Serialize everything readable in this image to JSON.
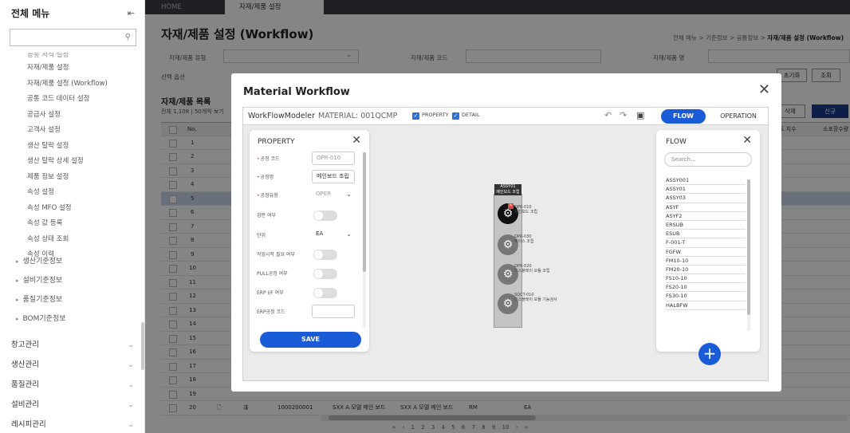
{
  "sidebar": {
    "title": "전체 메뉴",
    "search_placeholder": "",
    "cut_item": "공통 서식 설정",
    "sub_items": [
      "자재/제품 설정",
      "자재/제품 설정 (Workflow)",
      "공통 코드 데이터 설정",
      "공급사 설정",
      "고객사 설정",
      "생산 탈락 설정",
      "생산 탈락 상세 설정",
      "제품 정보 설정",
      "속성 설정",
      "속성 MFO 설정",
      "속성 값 등록",
      "속성 상태 조회",
      "속성 이력"
    ],
    "groups": [
      "생산기준정보",
      "설비기준정보",
      "품질기준정보",
      "BOM기준정보"
    ],
    "top_menus": [
      "창고관리",
      "생산관리",
      "품질관리",
      "설비관리",
      "레시피관리"
    ]
  },
  "tabs": {
    "home": "HOME",
    "active": "자재/제품 설정 (Workflow)"
  },
  "page": {
    "title": "자재/제품 설정 (Workflow)",
    "breadcrumb": [
      "전체 메뉴",
      "기준정보",
      "공통정보",
      "자재/제품 설정 (Workflow)"
    ],
    "filters": {
      "type_label": "자재/제품 유형",
      "code_label": "자재/제품 코드",
      "name_label": "자재/제품 명",
      "option_label": "선택 옵션"
    },
    "buttons": {
      "reset": "초기화",
      "search": "조회",
      "delete": "삭제",
      "new": "신규"
    },
    "list_title": "자재/제품 목록",
    "list_sub": "전체 1,108 | 50개씩 보기",
    "columns": [
      "No.",
      "트 치수",
      "소포장수량"
    ],
    "row_numbers": [
      "1",
      "2",
      "3",
      "4",
      "5",
      "6",
      "7",
      "8",
      "9",
      "10",
      "11",
      "12",
      "13",
      "14",
      "15",
      "16",
      "17",
      "18",
      "19",
      "20"
    ],
    "last_row": {
      "code": "1000200001",
      "name": "SXX A 모델 메인 보드",
      "name2": "SXX A 모델 메인 보드",
      "type": "RM",
      "unit": "EA"
    },
    "pager": "«  ‹  1  2  3  4  5  6  7  8  9  10  ›  »"
  },
  "modal": {
    "title": "Material Workflow",
    "modeler_name": "WorkFlowModeler",
    "modeler_material": "MATERIAL: 001QCMP",
    "check_property": "PROPERTY",
    "check_detail": "DETAIL",
    "btn_flow": "FLOW",
    "btn_operation": "OPERATION",
    "property": {
      "title": "PROPERTY",
      "rows": [
        {
          "label": "공정 코드",
          "value": "OPR-010"
        },
        {
          "label": "공정명",
          "value": "메인보드 조립"
        },
        {
          "label": "공정유형",
          "value": "OPER"
        },
        {
          "label": "검판 여부"
        },
        {
          "label": "단위",
          "value": "EA"
        },
        {
          "label": "작업시작 필요 여부"
        },
        {
          "label": "PULL공정 여부"
        },
        {
          "label": "ERP I/F 여부"
        },
        {
          "label": "ERP공정 코드",
          "value": ""
        }
      ],
      "save": "SAVE"
    },
    "canvas": {
      "flow_code": "ASSY01",
      "flow_name": "메인보드 조립",
      "nodes": [
        {
          "code": "OPR-010",
          "name": "메인보드 조립"
        },
        {
          "code": "OPR-030",
          "name": "케이스 조립"
        },
        {
          "code": "OPR-020",
          "name": "디스플레이 모듈 조립"
        },
        {
          "code": "SQCT-010",
          "name": "디스플레이 모듈 기능검사"
        }
      ]
    },
    "flow": {
      "title": "FLOW",
      "search_placeholder": "Search...",
      "items": [
        "ASSY001",
        "ASSY01",
        "ASSY03",
        "ASYF",
        "ASYF2",
        "ERSUB",
        "ESUB",
        "F-001-T",
        "FGFW",
        "FM10-10",
        "FM20-10",
        "FS10-10",
        "FS20-10",
        "FS30-10",
        "HALBFW"
      ]
    }
  }
}
